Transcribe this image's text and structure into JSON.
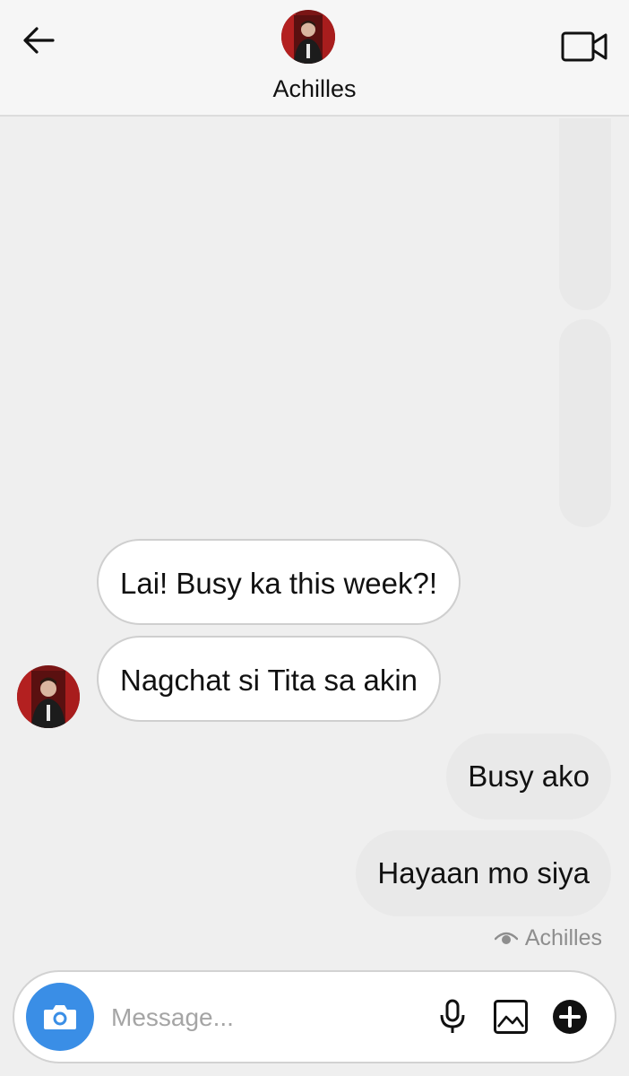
{
  "header": {
    "contact_name": "Achilles",
    "back_icon": "arrow-left-icon",
    "video_icon": "video-camera-icon"
  },
  "messages": [
    {
      "direction": "incoming",
      "text": "Lai! Busy ka this week?!"
    },
    {
      "direction": "incoming",
      "text": "Nagchat si Tita sa akin"
    },
    {
      "direction": "outgoing",
      "text": "Busy ako"
    },
    {
      "direction": "outgoing",
      "text": "Hayaan mo siya"
    }
  ],
  "seen_receipt": {
    "icon": "eye-icon",
    "label": "Achilles"
  },
  "composer": {
    "placeholder": "Message...",
    "value": "",
    "camera_icon": "camera-icon",
    "mic_icon": "microphone-icon",
    "gallery_icon": "image-icon",
    "plus_icon": "plus-circle-icon"
  },
  "colors": {
    "accent": "#3a8ee6",
    "background": "#efefef",
    "incoming_bubble": "#ffffff",
    "outgoing_bubble": "#e9e9e9"
  }
}
